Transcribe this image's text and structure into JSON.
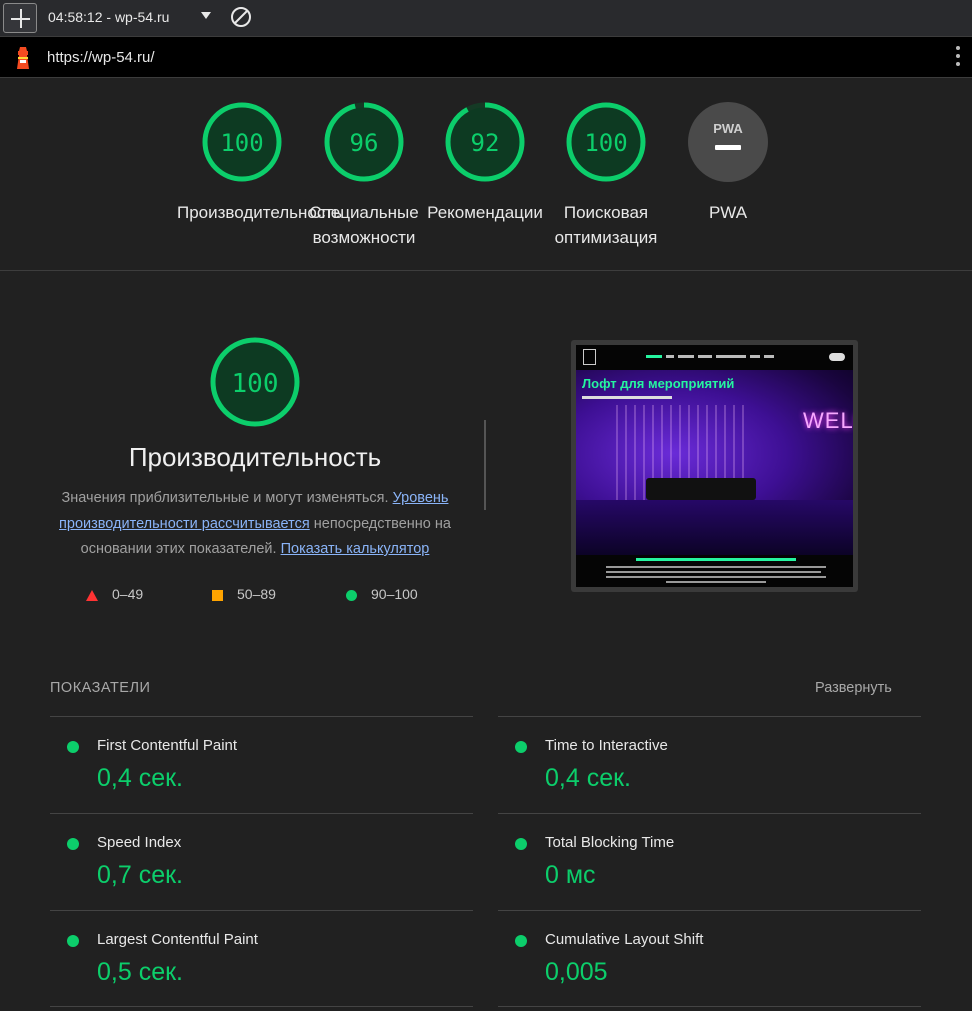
{
  "toolbar": {
    "report_title": "04:58:12 - wp-54.ru"
  },
  "urlbar": {
    "url": "https://wp-54.ru/"
  },
  "gauges": [
    {
      "score": "100",
      "label_lines": [
        "Производительность"
      ]
    },
    {
      "score": "96",
      "label_lines": [
        "Специальные",
        "возможности"
      ]
    },
    {
      "score": "92",
      "label_lines": [
        "Рекомендации"
      ]
    },
    {
      "score": "100",
      "label_lines": [
        "Поисковая",
        "оптимизация"
      ]
    },
    {
      "score": "",
      "label_lines": [
        "PWA"
      ],
      "badge": "PWA"
    }
  ],
  "performance": {
    "score": "100",
    "title": "Производительность",
    "desc_before": "Значения приблизительные и могут изменяться. ",
    "desc_link1": "Уровень производительности рассчитывается",
    "desc_middle": " непосредственно на основании этих показателей. ",
    "desc_link2": "Показать калькулятор",
    "legend": [
      {
        "range": "0–49",
        "shape": "triangle",
        "color": "#ff3333"
      },
      {
        "range": "50–89",
        "shape": "square",
        "color": "#ffa400"
      },
      {
        "range": "90–100",
        "shape": "circle",
        "color": "#0cce6b"
      }
    ]
  },
  "thumbnail": {
    "hero_title": "Лофт для мероприятий",
    "neon_sign": "WELCO"
  },
  "metrics": {
    "heading": "ПОКАЗАТЕЛИ",
    "expand_label": "Развернуть",
    "items": [
      {
        "name": "First Contentful Paint",
        "value": "0,4 сек."
      },
      {
        "name": "Time to Interactive",
        "value": "0,4 сек."
      },
      {
        "name": "Speed Index",
        "value": "0,7 сек."
      },
      {
        "name": "Total Blocking Time",
        "value": "0 мс"
      },
      {
        "name": "Largest Contentful Paint",
        "value": "0,5 сек."
      },
      {
        "name": "Cumulative Layout Shift",
        "value": "0,005"
      }
    ]
  },
  "colors": {
    "pass": "#0cce6b",
    "average": "#ffa400",
    "fail": "#ff3333",
    "link": "#8ab4f8"
  }
}
